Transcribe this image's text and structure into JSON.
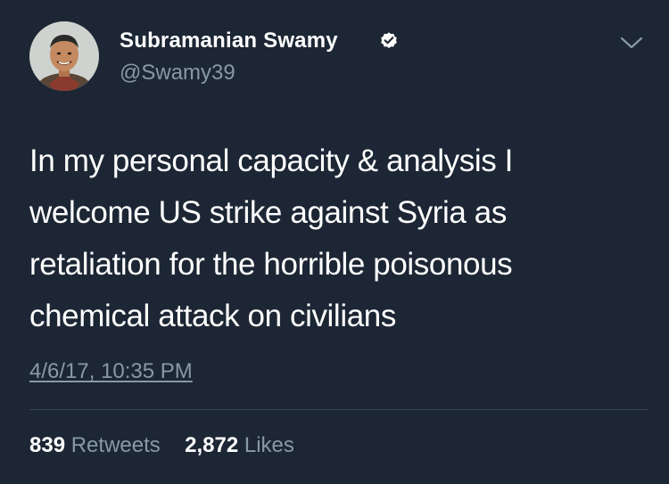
{
  "author": {
    "name": "Subramanian Swamy",
    "handle": "@Swamy39",
    "verified": true,
    "avatar_icon": "profile-photo"
  },
  "tweet": {
    "lines": [
      "In my personal capacity & analysis I",
      "welcome US strike against Syria as",
      "retaliation for the horrible poisonous",
      "chemical attack on civilians"
    ],
    "timestamp": "4/6/17, 10:35 PM"
  },
  "stats": {
    "retweets_count": "839",
    "retweets_label": "Retweets",
    "likes_count": "2,872",
    "likes_label": "Likes"
  },
  "colors": {
    "background": "#1c2634",
    "text": "#ffffff",
    "secondary": "#8899a6",
    "verified_badge": "#ffffff",
    "divider": "#38444d"
  }
}
